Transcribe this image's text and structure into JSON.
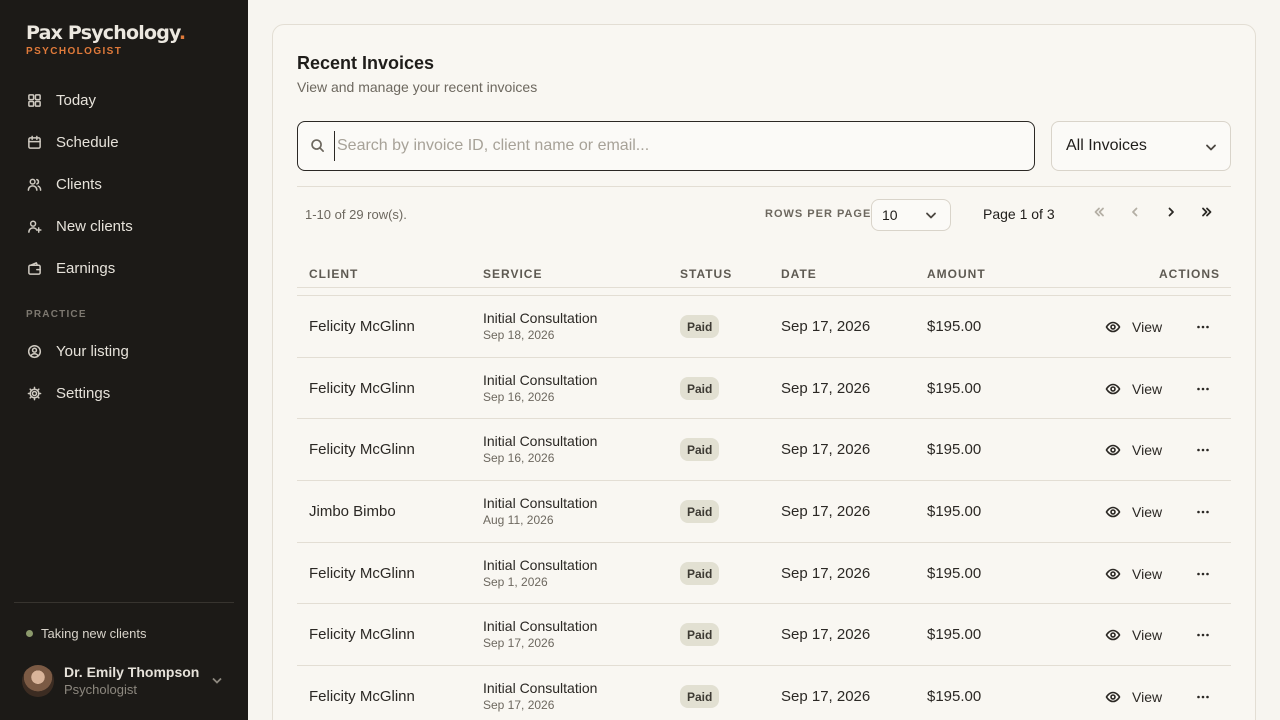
{
  "brand": {
    "name": "Pax Psychology",
    "dot": ".",
    "role": "PSYCHOLOGIST"
  },
  "nav": [
    {
      "label": "Today",
      "icon": "grid-icon"
    },
    {
      "label": "Schedule",
      "icon": "calendar-icon"
    },
    {
      "label": "Clients",
      "icon": "users-icon"
    },
    {
      "label": "New clients",
      "icon": "user-plus-icon"
    },
    {
      "label": "Earnings",
      "icon": "wallet-icon"
    }
  ],
  "practice_label": "PRACTICE",
  "practice_nav": [
    {
      "label": "Your listing",
      "icon": "user-circle-icon"
    },
    {
      "label": "Settings",
      "icon": "gear-icon"
    }
  ],
  "status": {
    "label": "Taking new clients",
    "color": "#8c9a6c"
  },
  "user": {
    "name": "Dr. Emily Thompson",
    "role": "Psychologist"
  },
  "page": {
    "title": "Recent Invoices",
    "subtitle": "View and manage your recent invoices"
  },
  "search": {
    "placeholder": "Search by invoice ID, client name or email...",
    "value": ""
  },
  "filter": {
    "selected": "All Invoices"
  },
  "pagination": {
    "rows_count": "1-10 of 29 row(s).",
    "rows_per_page_label": "ROWS PER PAGE",
    "rows_per_page": "10",
    "page_of": "Page 1 of 3"
  },
  "table": {
    "headers": {
      "client": "CLIENT",
      "service": "SERVICE",
      "status": "STATUS",
      "date": "DATE",
      "amount": "AMOUNT",
      "actions": "ACTIONS"
    },
    "view_label": "View",
    "rows": [
      {
        "client": "Felicity McGlinn",
        "service": "Initial Consultation",
        "service_date": "Sep 18, 2026",
        "status": "Paid",
        "date": "Sep 17, 2026",
        "amount": "$195.00"
      },
      {
        "client": "Felicity McGlinn",
        "service": "Initial Consultation",
        "service_date": "Sep 16, 2026",
        "status": "Paid",
        "date": "Sep 17, 2026",
        "amount": "$195.00"
      },
      {
        "client": "Felicity McGlinn",
        "service": "Initial Consultation",
        "service_date": "Sep 16, 2026",
        "status": "Paid",
        "date": "Sep 17, 2026",
        "amount": "$195.00"
      },
      {
        "client": "Jimbo Bimbo",
        "service": "Initial Consultation",
        "service_date": "Aug 11, 2026",
        "status": "Paid",
        "date": "Sep 17, 2026",
        "amount": "$195.00"
      },
      {
        "client": "Felicity McGlinn",
        "service": "Initial Consultation",
        "service_date": "Sep 1, 2026",
        "status": "Paid",
        "date": "Sep 17, 2026",
        "amount": "$195.00"
      },
      {
        "client": "Felicity McGlinn",
        "service": "Initial Consultation",
        "service_date": "Sep 17, 2026",
        "status": "Paid",
        "date": "Sep 17, 2026",
        "amount": "$195.00"
      },
      {
        "client": "Felicity McGlinn",
        "service": "Initial Consultation",
        "service_date": "Sep 17, 2026",
        "status": "Paid",
        "date": "Sep 17, 2026",
        "amount": "$195.00"
      }
    ]
  },
  "colors": {
    "sidebar_bg": "#1c1a17",
    "accent": "#e07a3a",
    "page_bg": "#f7f5f0",
    "badge_bg": "#e2e0d2"
  }
}
